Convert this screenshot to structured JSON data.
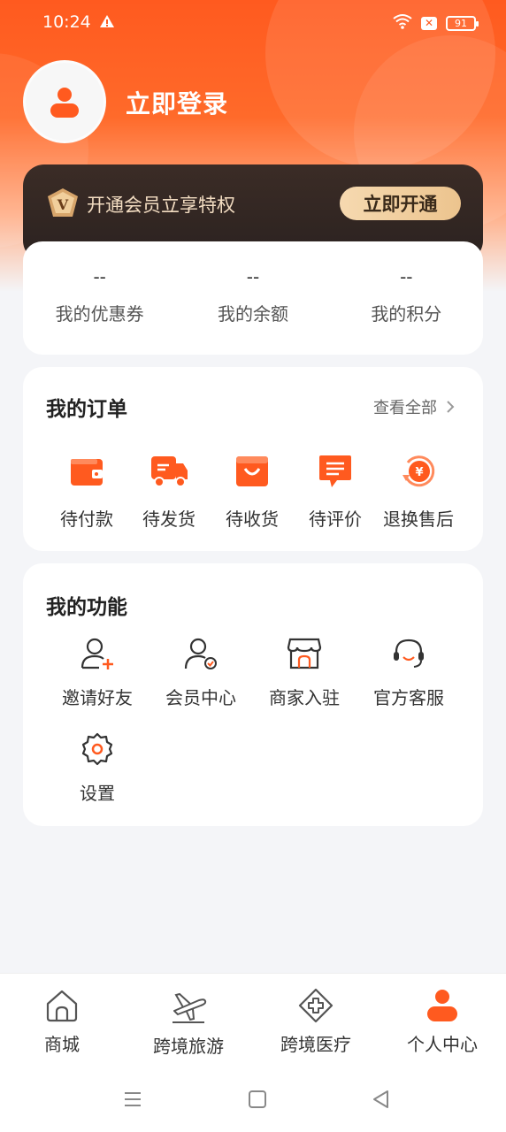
{
  "status_bar": {
    "time": "10:24",
    "battery": "91"
  },
  "header": {
    "login_label": "立即登录"
  },
  "vip": {
    "badge_letter": "V",
    "text": "开通会员立享特权",
    "button_label": "立即开通"
  },
  "assets": [
    {
      "value": "--",
      "label": "我的优惠券"
    },
    {
      "value": "--",
      "label": "我的余额"
    },
    {
      "value": "--",
      "label": "我的积分"
    }
  ],
  "orders": {
    "title": "我的订单",
    "view_all": "查看全部",
    "items": [
      {
        "label": "待付款",
        "icon": "wallet-icon"
      },
      {
        "label": "待发货",
        "icon": "truck-icon"
      },
      {
        "label": "待收货",
        "icon": "shopping-bag-icon"
      },
      {
        "label": "待评价",
        "icon": "comment-icon"
      },
      {
        "label": "退换售后",
        "icon": "refund-icon"
      }
    ]
  },
  "functions": {
    "title": "我的功能",
    "items": [
      {
        "label": "邀请好友",
        "icon": "invite-friend-icon"
      },
      {
        "label": "会员中心",
        "icon": "member-center-icon"
      },
      {
        "label": "商家入驻",
        "icon": "store-icon"
      },
      {
        "label": "官方客服",
        "icon": "headset-icon"
      },
      {
        "label": "设置",
        "icon": "settings-gear-icon"
      }
    ]
  },
  "bottom_nav": [
    {
      "label": "商城",
      "icon": "home-icon"
    },
    {
      "label": "跨境旅游",
      "icon": "airplane-icon"
    },
    {
      "label": "跨境医疗",
      "icon": "medical-cross-icon"
    },
    {
      "label": "个人中心",
      "icon": "user-icon",
      "active": true
    }
  ],
  "colors": {
    "accent": "#ff5a1f",
    "vip_dark": "#2b2220",
    "vip_gold": "#ecc48e"
  }
}
